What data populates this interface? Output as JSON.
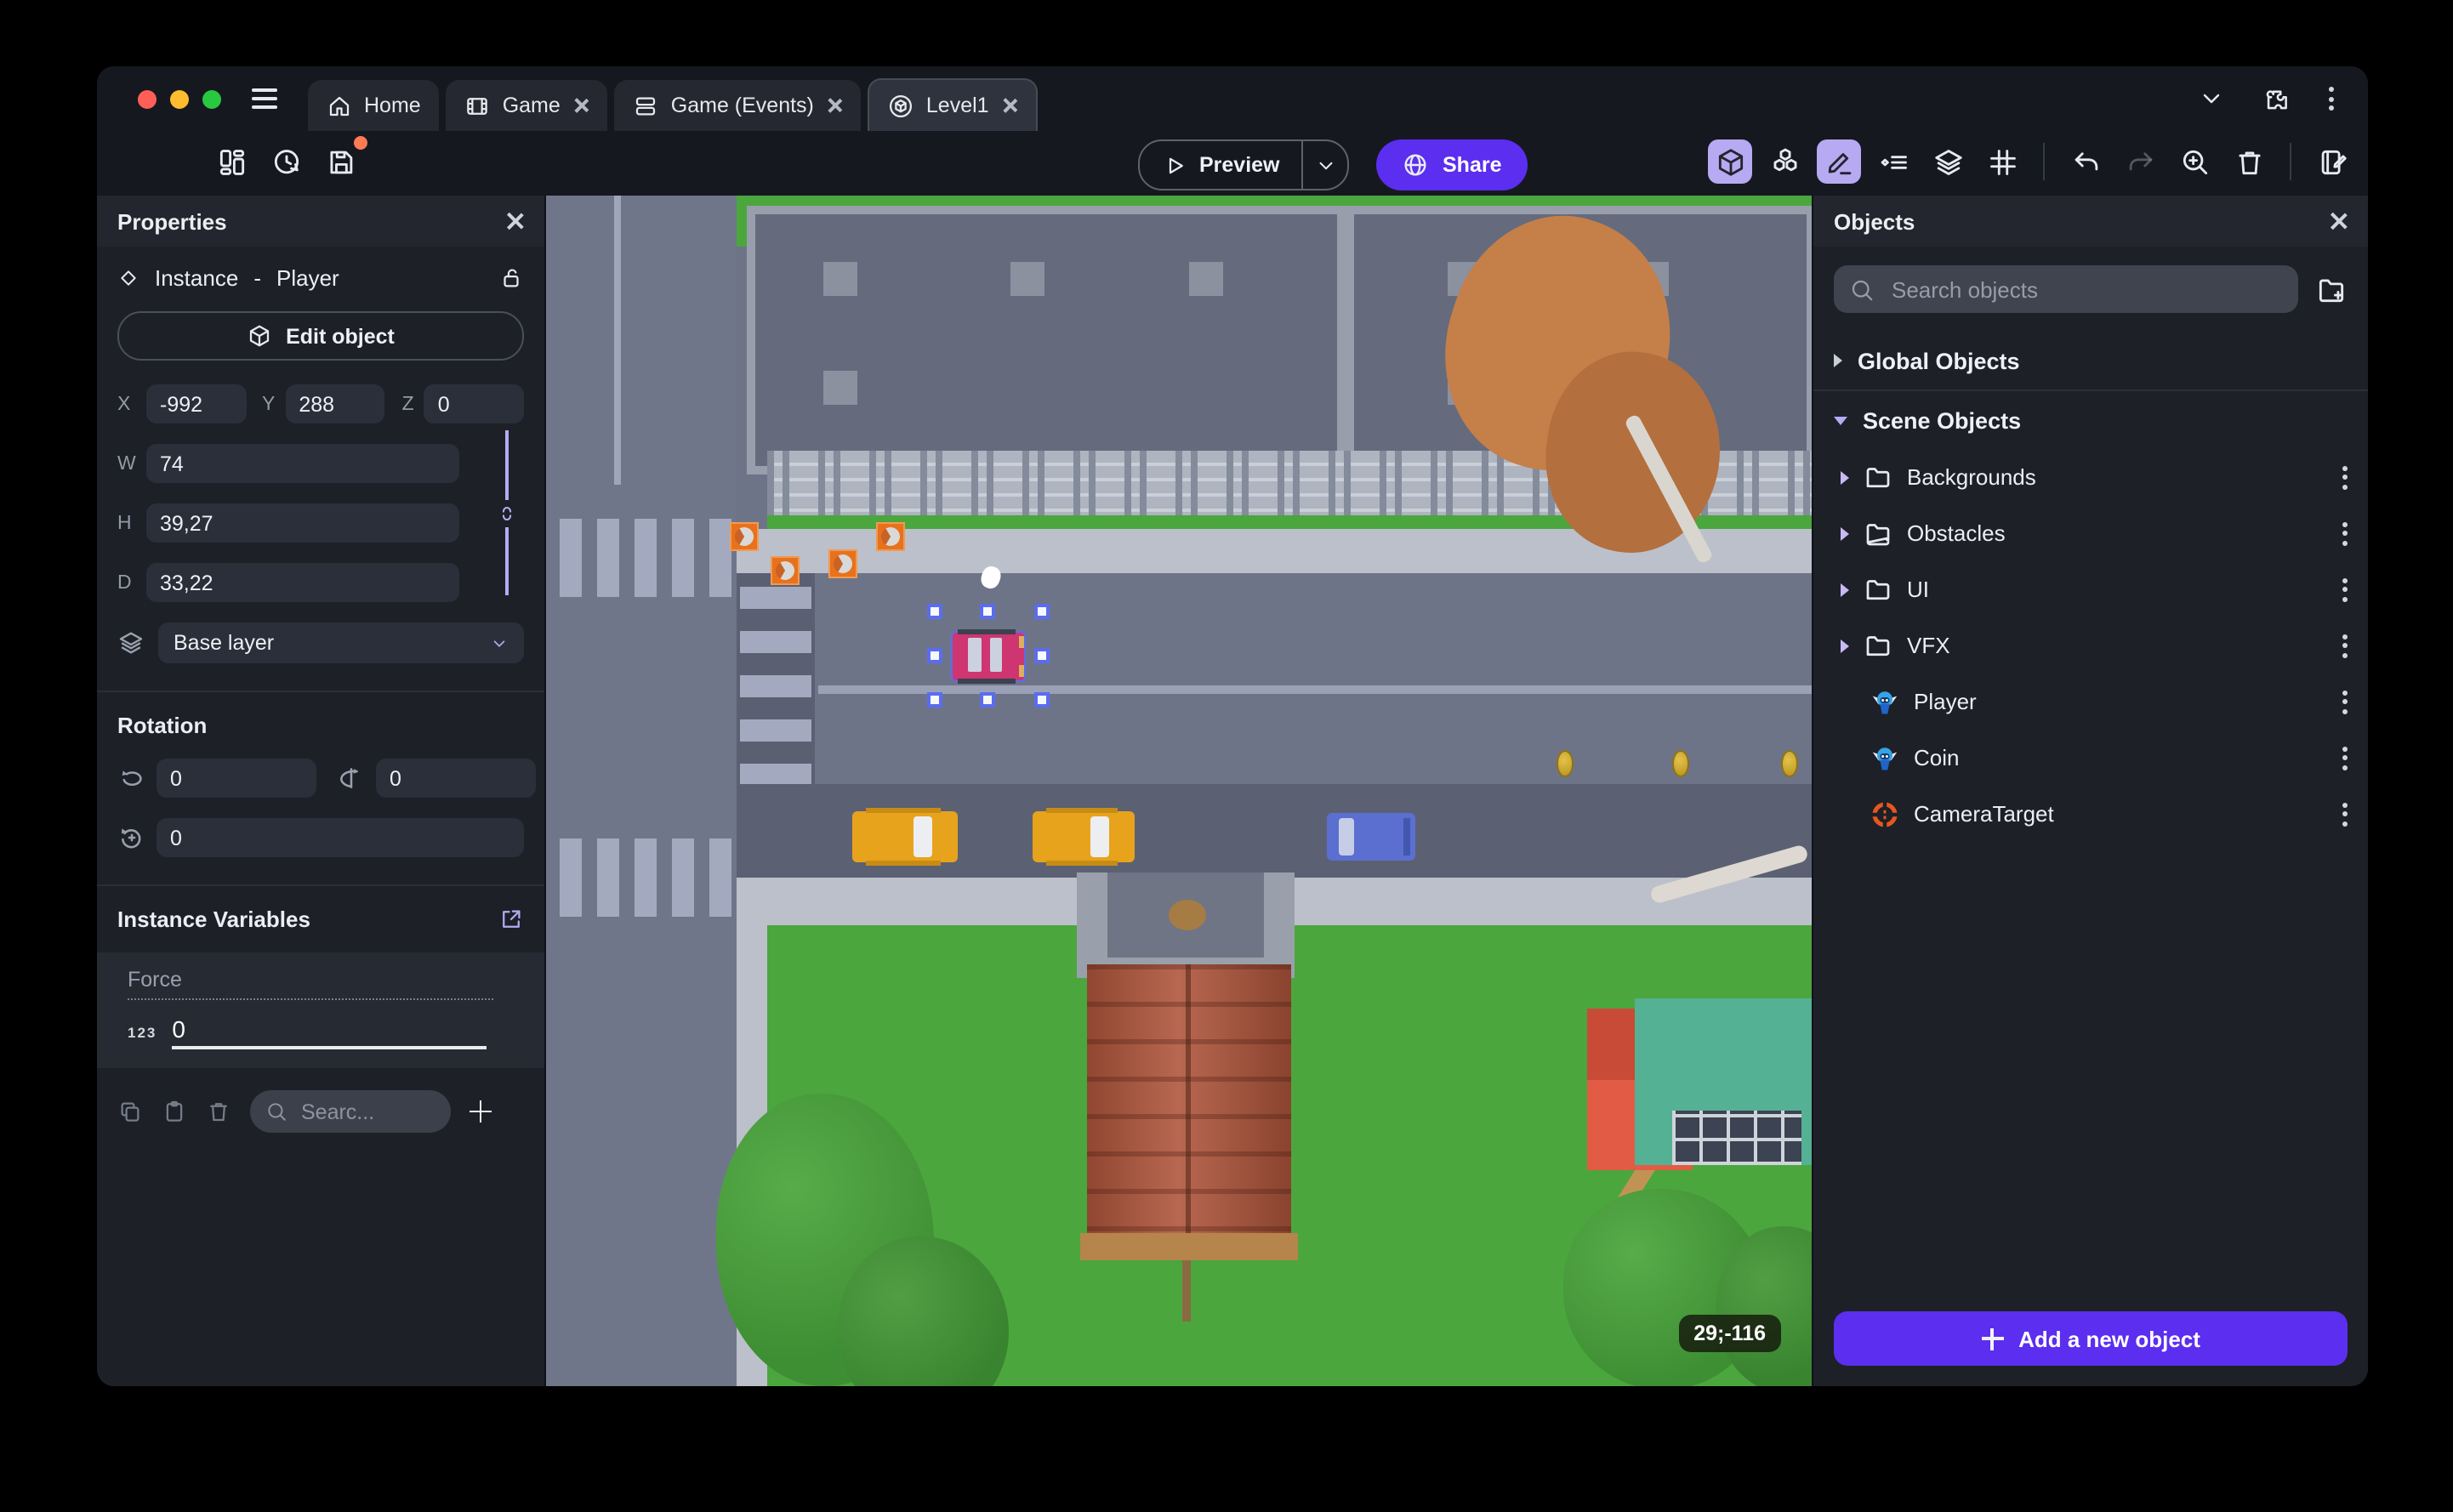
{
  "window": {
    "tabs": [
      {
        "label": "Home"
      },
      {
        "label": "Game"
      },
      {
        "label": "Game (Events)"
      },
      {
        "label": "Level1"
      }
    ]
  },
  "toolbar": {
    "preview_label": "Preview",
    "share_label": "Share"
  },
  "properties": {
    "title": "Properties",
    "instance_label": "Instance",
    "separator": "-",
    "object_name": "Player",
    "edit_object_label": "Edit object",
    "x_label": "X",
    "x_value": "-992",
    "y_label": "Y",
    "y_value": "288",
    "z_label": "Z",
    "z_value": "0",
    "w_label": "W",
    "w_value": "74",
    "h_label": "H",
    "h_value": "39,27",
    "d_label": "D",
    "d_value": "33,22",
    "layer_value": "Base layer",
    "rotation_title": "Rotation",
    "rot_x_value": "0",
    "rot_y_value": "0",
    "rot_z_value": "0",
    "variables_title": "Instance Variables",
    "variable_name": "Force",
    "variable_type_badge": "123",
    "variable_value": "0",
    "search_placeholder": "Searc..."
  },
  "objects_panel": {
    "title": "Objects",
    "search_placeholder": "Search objects",
    "global_section_label": "Global Objects",
    "scene_section_label": "Scene Objects",
    "items": [
      {
        "label": "Backgrounds",
        "type": "folder"
      },
      {
        "label": "Obstacles",
        "type": "folder"
      },
      {
        "label": "UI",
        "type": "folder"
      },
      {
        "label": "VFX",
        "type": "folder"
      },
      {
        "label": "Player",
        "type": "object-3d"
      },
      {
        "label": "Coin",
        "type": "object-3d"
      },
      {
        "label": "CameraTarget",
        "type": "camera-target"
      }
    ],
    "add_button_label": "Add a new object"
  },
  "canvas": {
    "coords_badge": "29;-116",
    "selected_instance": "Player"
  },
  "colors": {
    "accent_purple": "#5b2ef0",
    "accent_lavender": "#b7a9f2",
    "unsaved_dot": "#ff7b54",
    "road": "#6e7487",
    "grass": "#4ba63e",
    "selection_blue": "#5a6cf0"
  }
}
